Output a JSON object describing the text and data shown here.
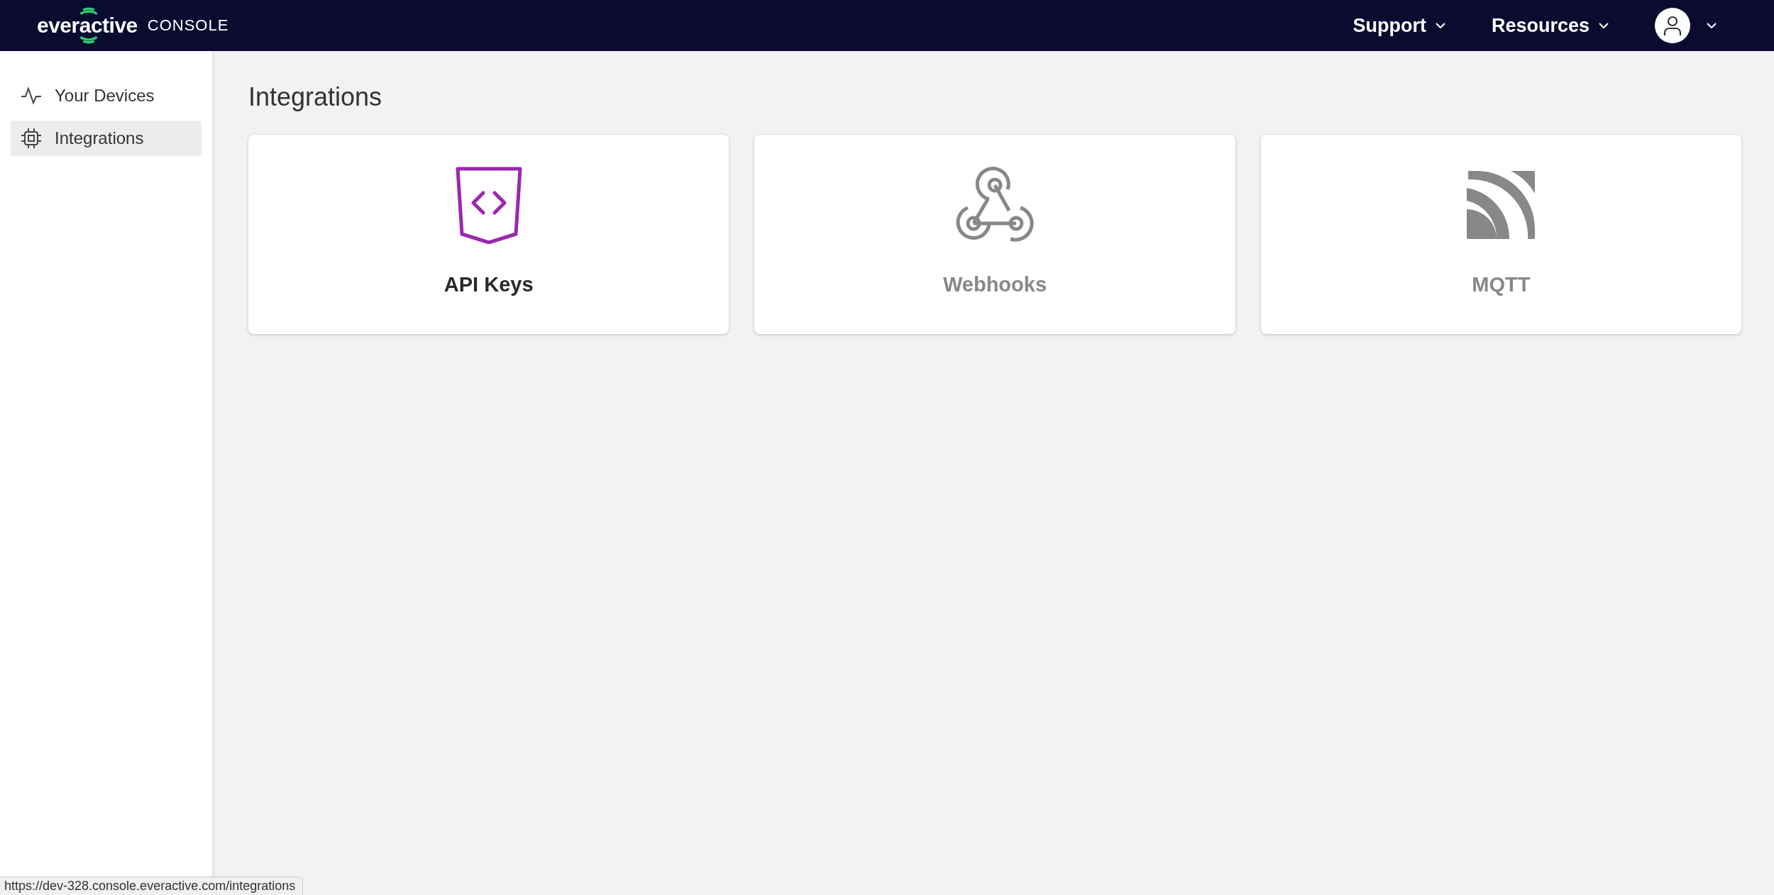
{
  "header": {
    "logo": "everactive",
    "product": "CONSOLE",
    "menus": [
      {
        "label": "Support"
      },
      {
        "label": "Resources"
      }
    ]
  },
  "sidebar": {
    "items": [
      {
        "label": "Your Devices",
        "kind": "pulse",
        "selected": false
      },
      {
        "label": "Integrations",
        "kind": "chip",
        "selected": true
      }
    ]
  },
  "page": {
    "title": "Integrations",
    "cards": [
      {
        "label": "API Keys",
        "kind": "code",
        "disabled": false
      },
      {
        "label": "Webhooks",
        "kind": "webhook",
        "disabled": true
      },
      {
        "label": "MQTT",
        "kind": "mqtt",
        "disabled": true
      }
    ]
  },
  "status_bar": {
    "url": "https://dev-328.console.everactive.com/integrations"
  }
}
